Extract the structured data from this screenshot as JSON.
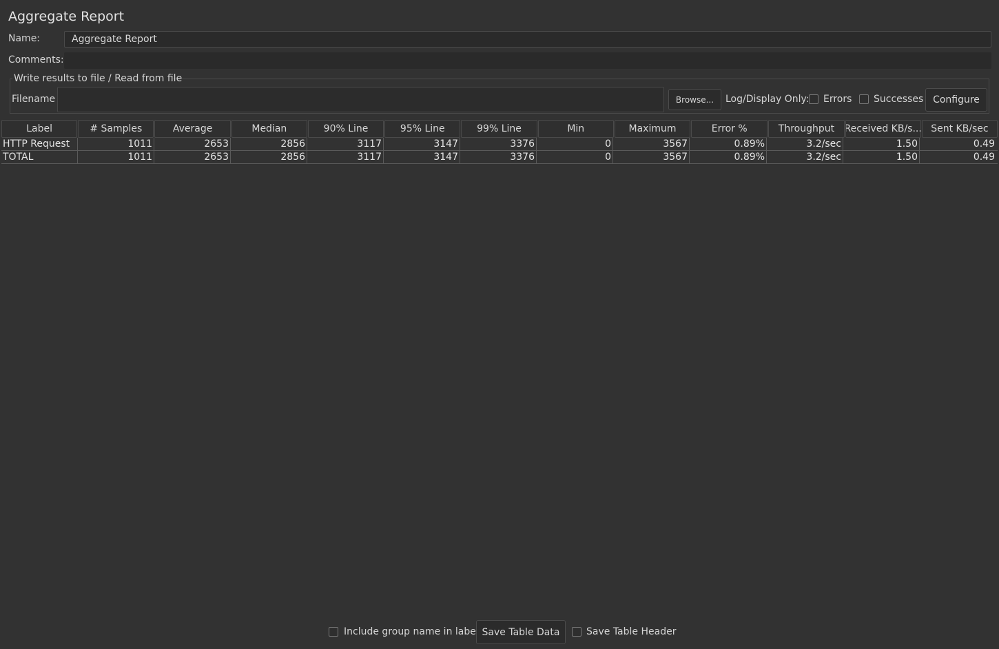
{
  "window": {
    "title": "Aggregate Report"
  },
  "form": {
    "name_label": "Name:",
    "name_value": "Aggregate Report",
    "comments_label": "Comments:",
    "comments_value": ""
  },
  "file_section": {
    "legend": "Write results to file / Read from file",
    "filename_label": "Filename",
    "filename_value": "",
    "browse_label": "Browse...",
    "log_display_label": "Log/Display Only:",
    "errors_label": "Errors",
    "errors_checked": false,
    "successes_label": "Successes",
    "successes_checked": false,
    "configure_label": "Configure"
  },
  "table": {
    "columns": [
      "Label",
      "# Samples",
      "Average",
      "Median",
      "90% Line",
      "95% Line",
      "99% Line",
      "Min",
      "Maximum",
      "Error %",
      "Throughput",
      "Received KB/s...",
      "Sent KB/sec"
    ],
    "rows": [
      [
        "HTTP Request",
        "1011",
        "2653",
        "2856",
        "3117",
        "3147",
        "3376",
        "0",
        "3567",
        "0.89%",
        "3.2/sec",
        "1.50",
        "0.49"
      ],
      [
        "TOTAL",
        "1011",
        "2653",
        "2856",
        "3117",
        "3147",
        "3376",
        "0",
        "3567",
        "0.89%",
        "3.2/sec",
        "1.50",
        "0.49"
      ]
    ]
  },
  "footer": {
    "include_group_label": "Include group name in label?",
    "include_group_checked": false,
    "save_table_data_label": "Save Table Data",
    "save_table_header_label": "Save Table Header",
    "save_table_header_checked": false
  }
}
